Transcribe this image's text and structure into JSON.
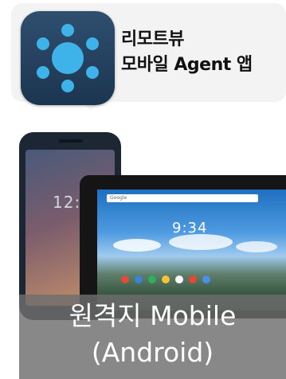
{
  "app": {
    "title_line1": "리모트뷰",
    "title_line2": "모바일 Agent 앱",
    "icon": "remoteview-agent-icon"
  },
  "devices": {
    "phone_clock": "12:0",
    "tablet_clock": "9:34",
    "tablet_search": "Google"
  },
  "caption": {
    "line1": "원격지 Mobile",
    "line2": "(Android)"
  }
}
